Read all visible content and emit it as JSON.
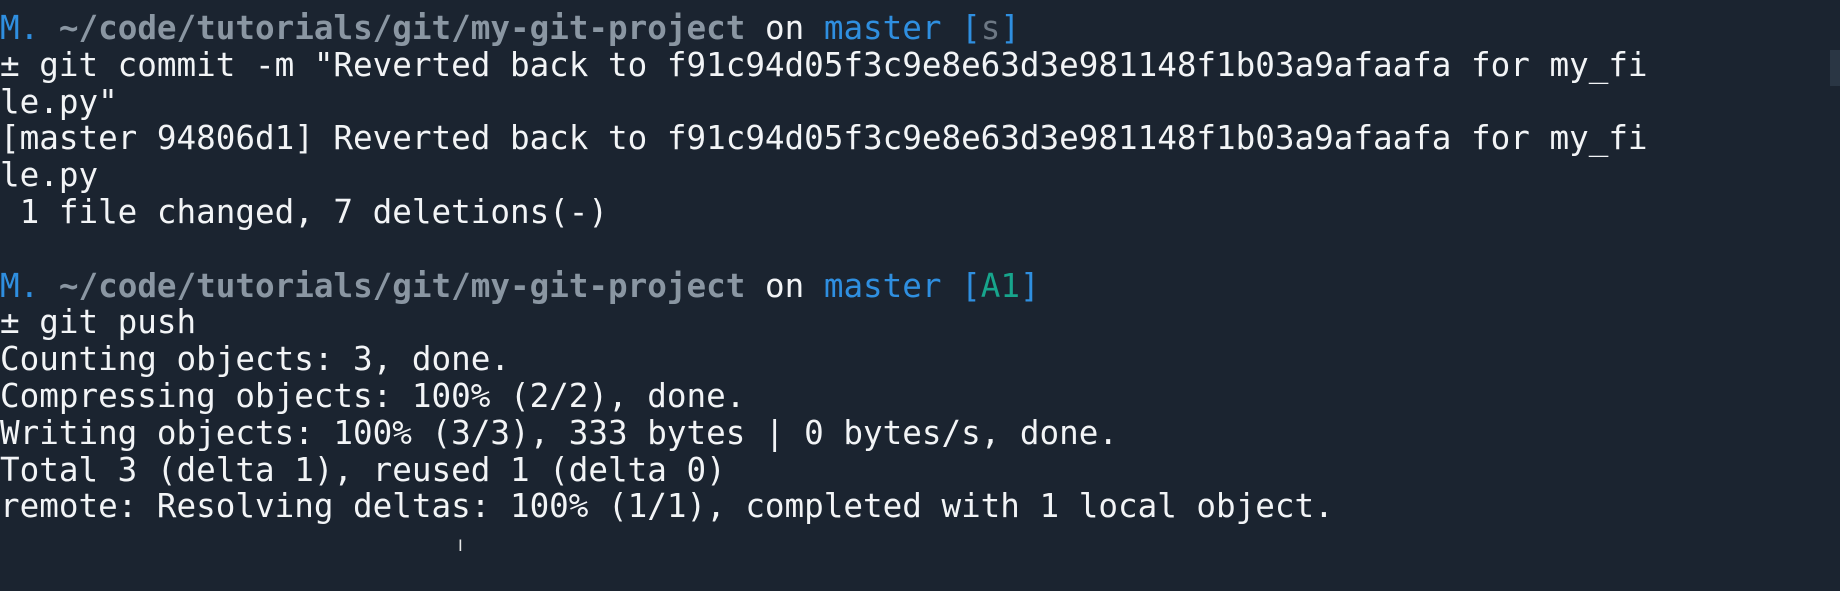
{
  "terminal": {
    "prompt1": {
      "user": "M.",
      "path": "~/code/tutorials/git/my-git-project",
      "on": "on",
      "branch": "master",
      "status_open": "[",
      "status": "s",
      "status_close": "]"
    },
    "cmd1_a": "± git commit -m \"Reverted back to f91c94d05f3c9e8e63d3e981148f1b03a9afaafa for my_fi",
    "cmd1_b": "le.py\"",
    "out1": [
      "[master 94806d1] Reverted back to f91c94d05f3c9e8e63d3e981148f1b03a9afaafa for my_fi",
      "le.py",
      " 1 file changed, 7 deletions(-)"
    ],
    "prompt2": {
      "user": "M.",
      "path": "~/code/tutorials/git/my-git-project",
      "on": "on",
      "branch": "master",
      "status_open": "[",
      "status": "A1",
      "status_close": "]"
    },
    "cmd2": "± git push",
    "out2": [
      "Counting objects: 3, done.",
      "Compressing objects: 100% (2/2), done.",
      "Writing objects: 100% (3/3), 333 bytes | 0 bytes/s, done.",
      "Total 3 (delta 1), reused 1 (delta 0)",
      "remote: Resolving deltas: 100% (1/1), completed with 1 local object."
    ],
    "cursor_glyph": "I"
  }
}
